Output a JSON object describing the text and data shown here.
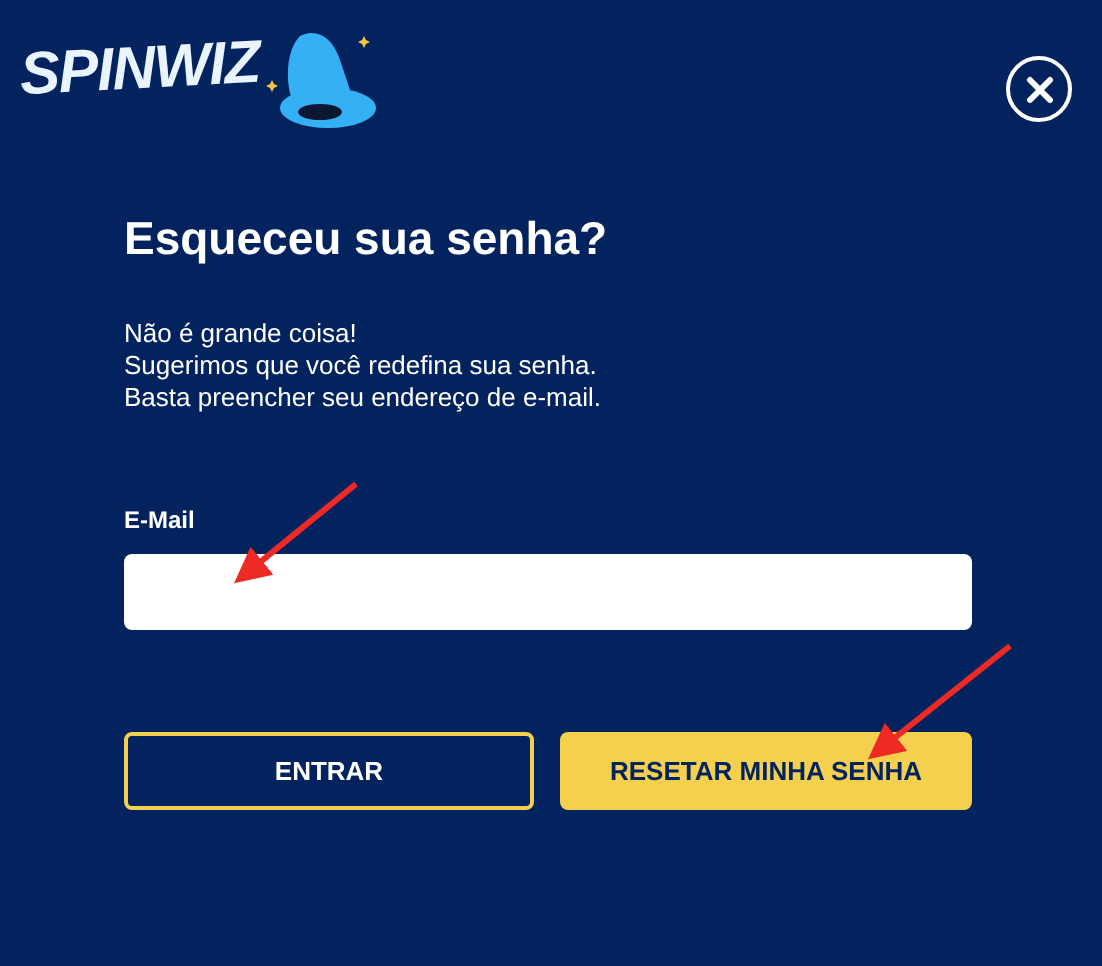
{
  "logo": {
    "text": "SPINWIZ"
  },
  "title": "Esqueceu sua senha?",
  "message": [
    "Não é grande coisa!",
    "Sugerimos que você redefina sua senha.",
    "Basta preencher seu endereço de e-mail."
  ],
  "email_field": {
    "label": "E-Mail"
  },
  "buttons": [
    {
      "label": "ENTRAR",
      "kind": "outline"
    },
    {
      "label": "RESETAR MINHA SENHA",
      "kind": "primary"
    }
  ]
}
